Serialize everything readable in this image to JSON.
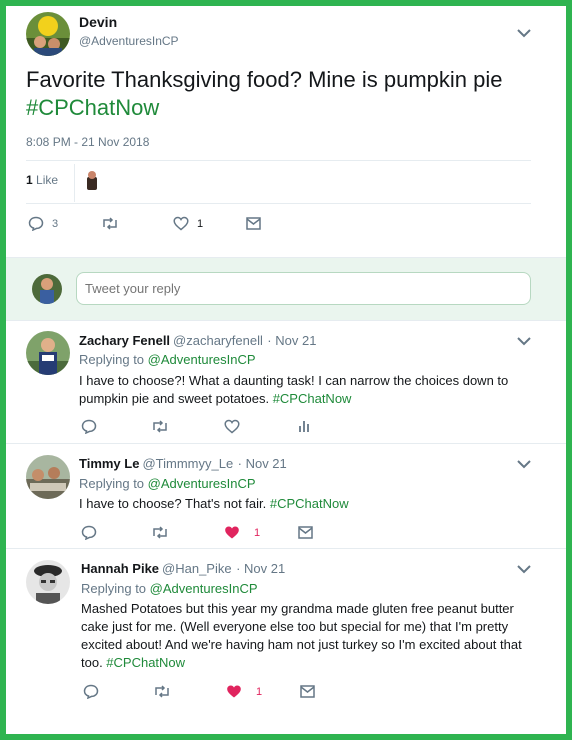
{
  "main_tweet": {
    "author_name": "Devin",
    "author_handle": "@AdventuresInCP",
    "text_prefix": "Favorite Thanksgiving food? Mine is pumpkin pie ",
    "hashtag": "#CPChatNow",
    "timestamp": "8:08 PM - 21 Nov 2018",
    "likes_count": "1",
    "likes_label": "Like",
    "reply_count": "3",
    "like_action_count": "1"
  },
  "reply_box": {
    "placeholder": "Tweet your reply"
  },
  "replies": [
    {
      "name": "Zachary Fenell",
      "handle": "@zacharyfenell",
      "date": "· Nov 21",
      "replying_label": "Replying to",
      "replying_to": "@AdventuresInCP",
      "text": "I have to choose?! What a daunting task! I can narrow the choices down to pumpkin pie and sweet potatoes. ",
      "hashtag": "#CPChatNow"
    },
    {
      "name": "Timmy Le",
      "handle": "@Timmmyy_Le",
      "date": "· Nov 21",
      "replying_label": "Replying to",
      "replying_to": "@AdventuresInCP",
      "text": "I have to choose? That's not fair. ",
      "hashtag": "#CPChatNow",
      "like_count": "1"
    },
    {
      "name": "Hannah Pike",
      "handle": "@Han_Pike",
      "date": "· Nov 21",
      "replying_label": "Replying to",
      "replying_to": "@AdventuresInCP",
      "text": "Mashed Potatoes but this year my grandma made gluten free peanut butter cake just for me. (Well everyone else too but special for me) that I'm pretty excited about! And we're having ham not just turkey so I'm excited about that too. ",
      "hashtag": "#CPChatNow",
      "like_count": "1"
    }
  ],
  "colors": {
    "frame_border": "#2fb450",
    "link": "#1f8a3a",
    "like_red": "#e0245e",
    "muted": "#657786"
  },
  "icons": [
    "chevron-down-icon",
    "reply-icon",
    "retweet-icon",
    "heart-icon",
    "dm-icon",
    "analytics-icon"
  ]
}
